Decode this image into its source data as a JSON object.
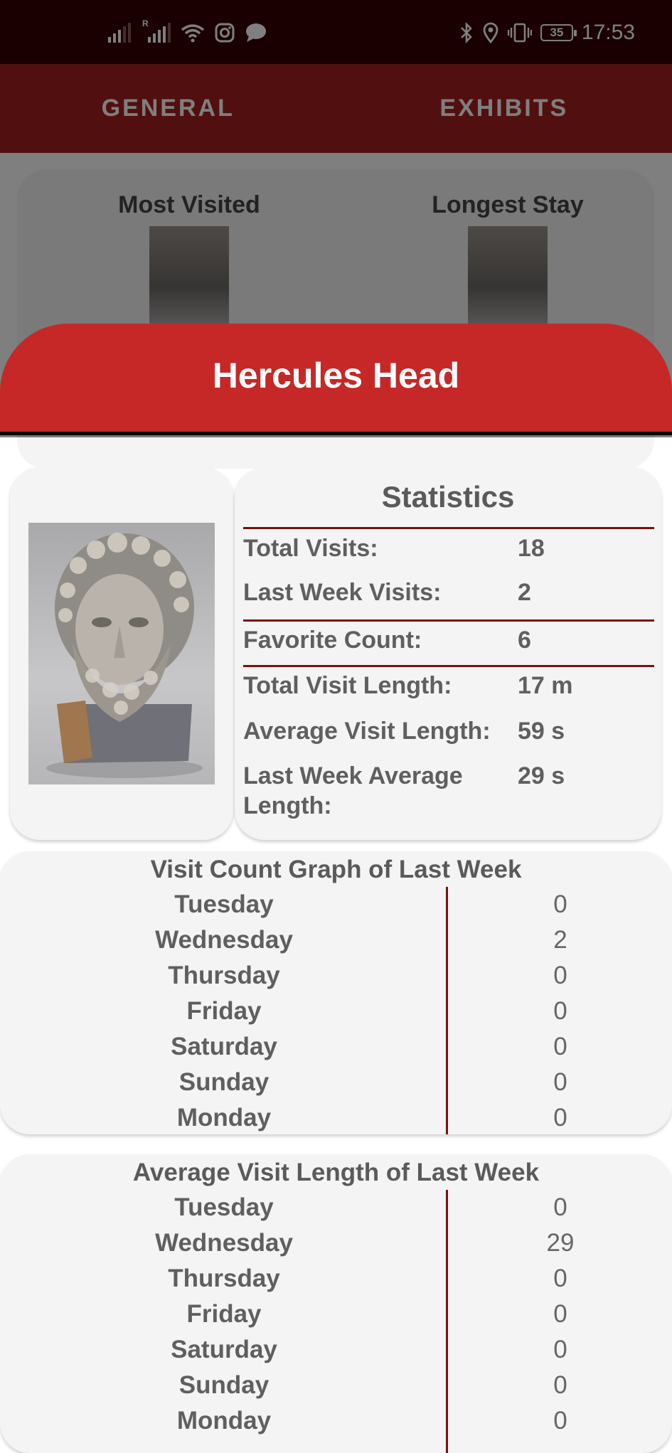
{
  "status_bar": {
    "time": "17:53",
    "battery": "35",
    "roaming_label": "R"
  },
  "tabs": [
    {
      "label": "GENERAL"
    },
    {
      "label": "EXHIBITS"
    }
  ],
  "background_card": {
    "most_visited": "Most Visited",
    "longest_stay": "Longest Stay"
  },
  "sheet": {
    "title": "Hercules Head"
  },
  "statistics": {
    "title": "Statistics",
    "rows": [
      {
        "label": "Total Visits:",
        "value": "18"
      },
      {
        "label": "Last Week Visits:",
        "value": "2"
      },
      {
        "label": "Favorite Count:",
        "value": "6"
      },
      {
        "label": "Total Visit Length:",
        "value": "17 m"
      },
      {
        "label": "Average Visit Length:",
        "value": "59 s"
      },
      {
        "label": "Last Week Average Length:",
        "value": "29 s"
      }
    ]
  },
  "visit_count_graph": {
    "title": "Visit Count Graph of Last Week",
    "rows": [
      {
        "day": "Tuesday",
        "value": "0"
      },
      {
        "day": "Wednesday",
        "value": "2"
      },
      {
        "day": "Thursday",
        "value": "0"
      },
      {
        "day": "Friday",
        "value": "0"
      },
      {
        "day": "Saturday",
        "value": "0"
      },
      {
        "day": "Sunday",
        "value": "0"
      },
      {
        "day": "Monday",
        "value": "0"
      }
    ]
  },
  "avg_length_graph": {
    "title": "Average Visit Length of Last Week",
    "rows": [
      {
        "day": "Tuesday",
        "value": "0"
      },
      {
        "day": "Wednesday",
        "value": "29"
      },
      {
        "day": "Thursday",
        "value": "0"
      },
      {
        "day": "Friday",
        "value": "0"
      },
      {
        "day": "Saturday",
        "value": "0"
      },
      {
        "day": "Sunday",
        "value": "0"
      },
      {
        "day": "Monday",
        "value": "0"
      }
    ]
  },
  "colors": {
    "status_bar": "#340000",
    "tab_bar": "#a41e1e",
    "sheet_header": "#c62828",
    "divider": "#7a0f0f",
    "card_bg": "#f4f4f4"
  }
}
